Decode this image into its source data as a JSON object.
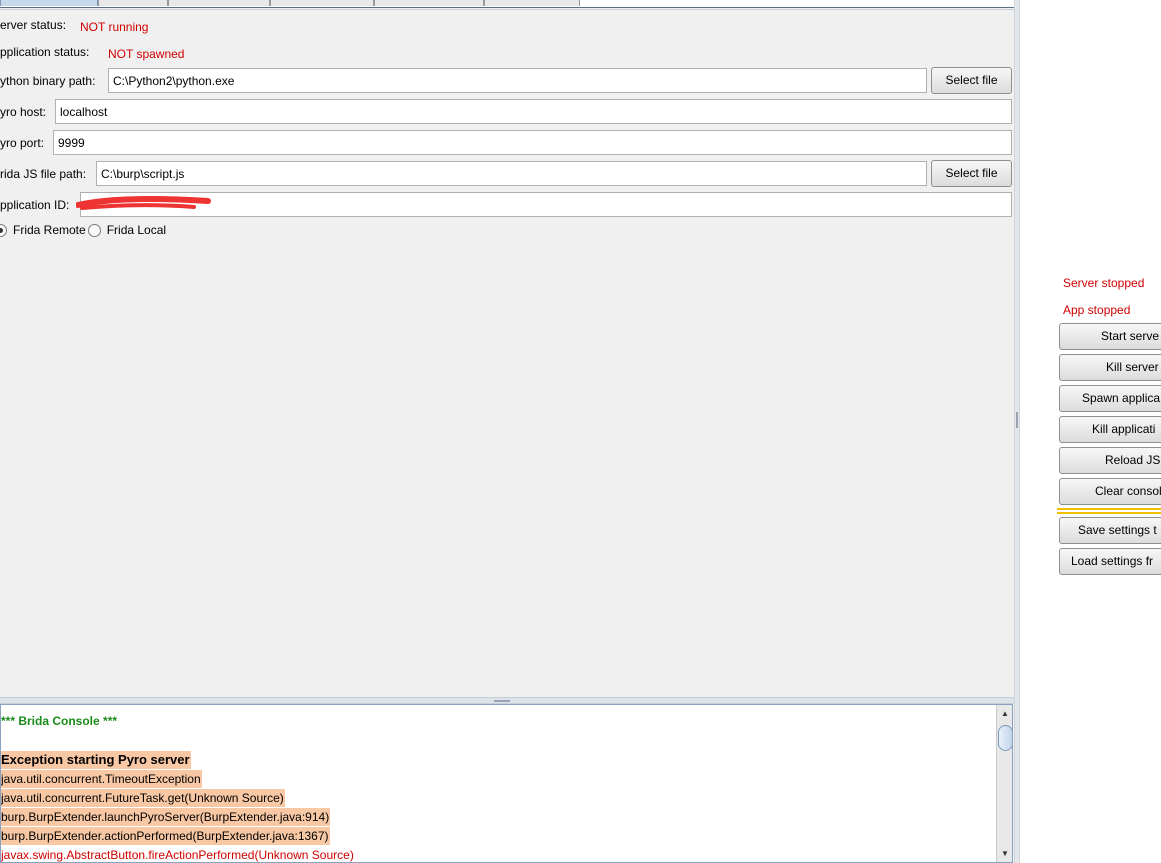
{
  "settings": {
    "server_status_label": "erver status:",
    "server_status_value": "NOT running",
    "application_status_label": "pplication status:",
    "application_status_value": "NOT spawned",
    "python_binary_label": "ython binary path:",
    "python_binary_value": "C:\\Python2\\python.exe",
    "pyro_host_label": "yro host:",
    "pyro_host_value": "localhost",
    "pyro_port_label": "yro port:",
    "pyro_port_value": "9999",
    "frida_js_label": "rida JS file path:",
    "frida_js_value": "C:\\burp\\script.js",
    "application_id_label": "pplication ID:",
    "select_file_label": "Select file",
    "mode": {
      "remote_label": "Frida Remote",
      "local_label": "Frida Local",
      "selected": "remote"
    }
  },
  "console": {
    "title": "*** Brida Console ***",
    "lines": [
      "Exception starting Pyro server",
      "java.util.concurrent.TimeoutException",
      "java.util.concurrent.FutureTask.get(Unknown Source)",
      "burp.BurpExtender.launchPyroServer(BurpExtender.java:914)",
      "burp.BurpExtender.actionPerformed(BurpExtender.java:1367)",
      "javax.swing.AbstractButton.fireActionPerformed(Unknown Source)"
    ]
  },
  "right_panel": {
    "server_status": "Server stopped",
    "app_status": "App stopped",
    "buttons": [
      "Start serve",
      "Kill server",
      "Spawn applica",
      "Kill applicati",
      "Reload JS",
      "Clear consol",
      "Save settings t",
      "Load settings fr"
    ]
  },
  "colors": {
    "status_red": "#d00000",
    "console_title_green": "#1a8a1a",
    "highlight_orange": "#f8c8a4",
    "separator_yellow": "#f0c000"
  }
}
